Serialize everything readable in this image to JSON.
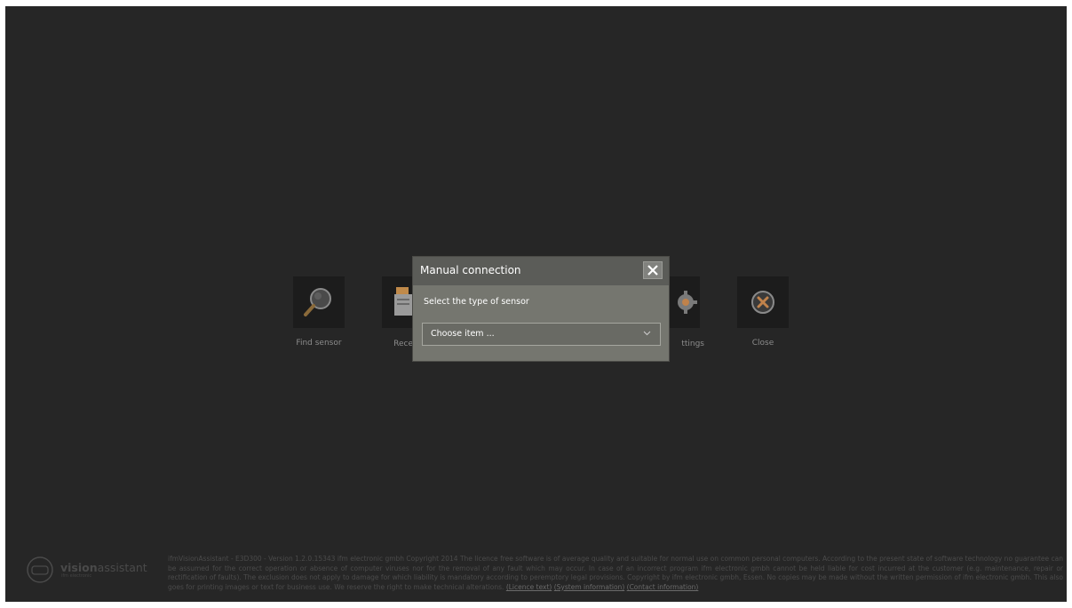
{
  "tiles": {
    "find_label": "Find sensor",
    "recent_partial_label": "Rece",
    "settings_partial_label": "ttings",
    "close_label": "Close"
  },
  "modal": {
    "title": "Manual connection",
    "close_symbol": "✕",
    "prompt": "Select the type of sensor",
    "select_value": "Choose item ..."
  },
  "footer": {
    "brand_bold": "vision",
    "brand_rest": "assistant",
    "brand_sub": "ifm electronic",
    "text": "ifmVisionAssistant - E3D300 - Version 1.2.0.15343  ifm electronic gmbh Copyright 2014 The licence free software is of average quality and suitable for normal use on common personal computers. According to the present state of software technology no guarantee can be assumed for the correct operation or absence of computer viruses nor for the removal of any fault which may occur. In case of an incorrect program ifm electronic gmbh cannot be held liable for cost incurred at the customer (e.g. maintenance, repair or rectification of faults). The exclusion does not apply to damage for which liability is mandatory according to peremptory legal provisions. Copyright by ifm electronic gmbh, Essen. No copies may be made without the written permission of ifm electronic gmbh. This also goes for printing images or text for business use. We reserve the right to make technical alterations.",
    "link_licence": "(Licence text)",
    "link_system": "(System information)",
    "link_contact": "(Contact information)"
  },
  "colors": {
    "background": "#262626",
    "modal": "#75766f",
    "modal_header": "#5b5c58",
    "close_accent": "#c0824b"
  }
}
